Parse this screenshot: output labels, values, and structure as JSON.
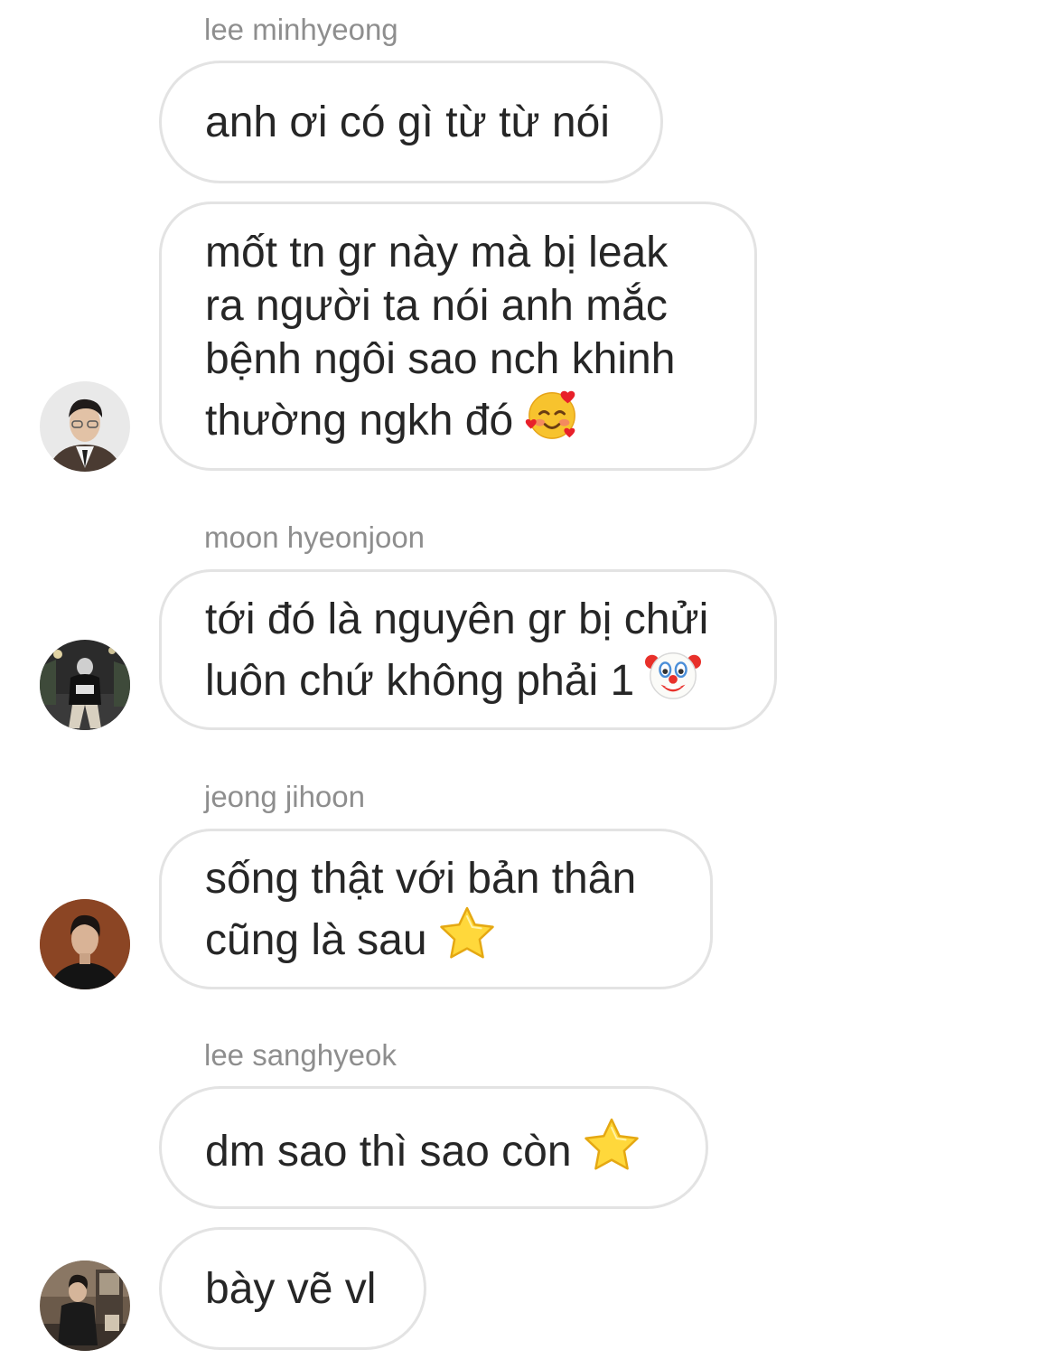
{
  "messages": [
    {
      "sender": "lee minhyeong",
      "bubbles": [
        {
          "text": "anh ơi có gì từ từ nói"
        },
        {
          "text": "mốt tn gr này mà bị leak\nra người ta nói anh mắc\nbệnh ngôi sao nch khinh\nthường ngkh đó",
          "emoji": "smiling-face-with-hearts"
        }
      ]
    },
    {
      "sender": "moon hyeonjoon",
      "bubbles": [
        {
          "text": "tới đó là nguyên gr bị chửi\nluôn chứ không phải 1",
          "emoji": "clown-face"
        }
      ]
    },
    {
      "sender": "jeong jihoon",
      "bubbles": [
        {
          "text": "sống thật với bản thân\ncũng là sau",
          "emoji": "star"
        }
      ]
    },
    {
      "sender": "lee sanghyeok",
      "bubbles": [
        {
          "text": "dm sao thì sao còn",
          "emoji": "star"
        },
        {
          "text": "bày vẽ vl"
        }
      ]
    }
  ],
  "colors": {
    "sender_name": "#8e8e8e",
    "bubble_border": "#e3e3e3",
    "message_text": "#262626",
    "background": "#ffffff"
  }
}
